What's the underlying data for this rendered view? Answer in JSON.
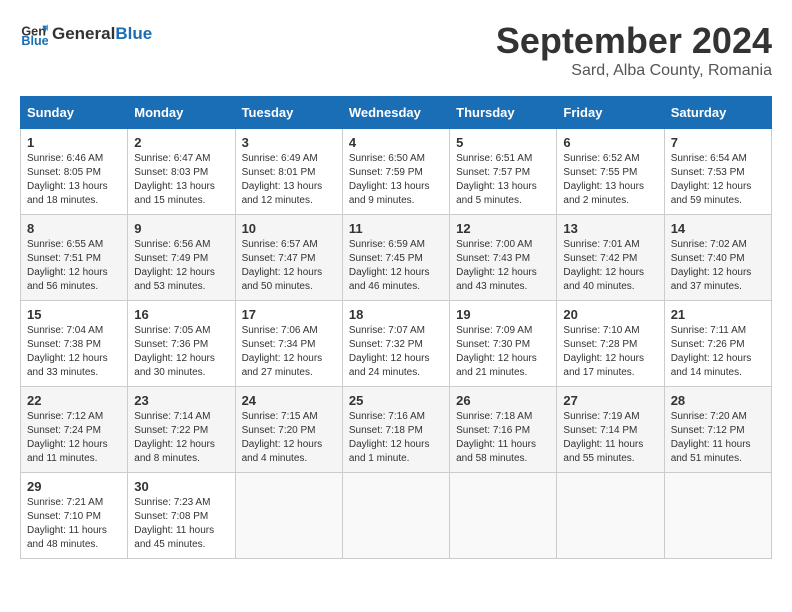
{
  "logo": {
    "text_general": "General",
    "text_blue": "Blue"
  },
  "header": {
    "title": "September 2024",
    "subtitle": "Sard, Alba County, Romania"
  },
  "columns": [
    "Sunday",
    "Monday",
    "Tuesday",
    "Wednesday",
    "Thursday",
    "Friday",
    "Saturday"
  ],
  "weeks": [
    [
      {
        "day": "1",
        "sunrise": "Sunrise: 6:46 AM",
        "sunset": "Sunset: 8:05 PM",
        "daylight": "Daylight: 13 hours and 18 minutes."
      },
      {
        "day": "2",
        "sunrise": "Sunrise: 6:47 AM",
        "sunset": "Sunset: 8:03 PM",
        "daylight": "Daylight: 13 hours and 15 minutes."
      },
      {
        "day": "3",
        "sunrise": "Sunrise: 6:49 AM",
        "sunset": "Sunset: 8:01 PM",
        "daylight": "Daylight: 13 hours and 12 minutes."
      },
      {
        "day": "4",
        "sunrise": "Sunrise: 6:50 AM",
        "sunset": "Sunset: 7:59 PM",
        "daylight": "Daylight: 13 hours and 9 minutes."
      },
      {
        "day": "5",
        "sunrise": "Sunrise: 6:51 AM",
        "sunset": "Sunset: 7:57 PM",
        "daylight": "Daylight: 13 hours and 5 minutes."
      },
      {
        "day": "6",
        "sunrise": "Sunrise: 6:52 AM",
        "sunset": "Sunset: 7:55 PM",
        "daylight": "Daylight: 13 hours and 2 minutes."
      },
      {
        "day": "7",
        "sunrise": "Sunrise: 6:54 AM",
        "sunset": "Sunset: 7:53 PM",
        "daylight": "Daylight: 12 hours and 59 minutes."
      }
    ],
    [
      {
        "day": "8",
        "sunrise": "Sunrise: 6:55 AM",
        "sunset": "Sunset: 7:51 PM",
        "daylight": "Daylight: 12 hours and 56 minutes."
      },
      {
        "day": "9",
        "sunrise": "Sunrise: 6:56 AM",
        "sunset": "Sunset: 7:49 PM",
        "daylight": "Daylight: 12 hours and 53 minutes."
      },
      {
        "day": "10",
        "sunrise": "Sunrise: 6:57 AM",
        "sunset": "Sunset: 7:47 PM",
        "daylight": "Daylight: 12 hours and 50 minutes."
      },
      {
        "day": "11",
        "sunrise": "Sunrise: 6:59 AM",
        "sunset": "Sunset: 7:45 PM",
        "daylight": "Daylight: 12 hours and 46 minutes."
      },
      {
        "day": "12",
        "sunrise": "Sunrise: 7:00 AM",
        "sunset": "Sunset: 7:43 PM",
        "daylight": "Daylight: 12 hours and 43 minutes."
      },
      {
        "day": "13",
        "sunrise": "Sunrise: 7:01 AM",
        "sunset": "Sunset: 7:42 PM",
        "daylight": "Daylight: 12 hours and 40 minutes."
      },
      {
        "day": "14",
        "sunrise": "Sunrise: 7:02 AM",
        "sunset": "Sunset: 7:40 PM",
        "daylight": "Daylight: 12 hours and 37 minutes."
      }
    ],
    [
      {
        "day": "15",
        "sunrise": "Sunrise: 7:04 AM",
        "sunset": "Sunset: 7:38 PM",
        "daylight": "Daylight: 12 hours and 33 minutes."
      },
      {
        "day": "16",
        "sunrise": "Sunrise: 7:05 AM",
        "sunset": "Sunset: 7:36 PM",
        "daylight": "Daylight: 12 hours and 30 minutes."
      },
      {
        "day": "17",
        "sunrise": "Sunrise: 7:06 AM",
        "sunset": "Sunset: 7:34 PM",
        "daylight": "Daylight: 12 hours and 27 minutes."
      },
      {
        "day": "18",
        "sunrise": "Sunrise: 7:07 AM",
        "sunset": "Sunset: 7:32 PM",
        "daylight": "Daylight: 12 hours and 24 minutes."
      },
      {
        "day": "19",
        "sunrise": "Sunrise: 7:09 AM",
        "sunset": "Sunset: 7:30 PM",
        "daylight": "Daylight: 12 hours and 21 minutes."
      },
      {
        "day": "20",
        "sunrise": "Sunrise: 7:10 AM",
        "sunset": "Sunset: 7:28 PM",
        "daylight": "Daylight: 12 hours and 17 minutes."
      },
      {
        "day": "21",
        "sunrise": "Sunrise: 7:11 AM",
        "sunset": "Sunset: 7:26 PM",
        "daylight": "Daylight: 12 hours and 14 minutes."
      }
    ],
    [
      {
        "day": "22",
        "sunrise": "Sunrise: 7:12 AM",
        "sunset": "Sunset: 7:24 PM",
        "daylight": "Daylight: 12 hours and 11 minutes."
      },
      {
        "day": "23",
        "sunrise": "Sunrise: 7:14 AM",
        "sunset": "Sunset: 7:22 PM",
        "daylight": "Daylight: 12 hours and 8 minutes."
      },
      {
        "day": "24",
        "sunrise": "Sunrise: 7:15 AM",
        "sunset": "Sunset: 7:20 PM",
        "daylight": "Daylight: 12 hours and 4 minutes."
      },
      {
        "day": "25",
        "sunrise": "Sunrise: 7:16 AM",
        "sunset": "Sunset: 7:18 PM",
        "daylight": "Daylight: 12 hours and 1 minute."
      },
      {
        "day": "26",
        "sunrise": "Sunrise: 7:18 AM",
        "sunset": "Sunset: 7:16 PM",
        "daylight": "Daylight: 11 hours and 58 minutes."
      },
      {
        "day": "27",
        "sunrise": "Sunrise: 7:19 AM",
        "sunset": "Sunset: 7:14 PM",
        "daylight": "Daylight: 11 hours and 55 minutes."
      },
      {
        "day": "28",
        "sunrise": "Sunrise: 7:20 AM",
        "sunset": "Sunset: 7:12 PM",
        "daylight": "Daylight: 11 hours and 51 minutes."
      }
    ],
    [
      {
        "day": "29",
        "sunrise": "Sunrise: 7:21 AM",
        "sunset": "Sunset: 7:10 PM",
        "daylight": "Daylight: 11 hours and 48 minutes."
      },
      {
        "day": "30",
        "sunrise": "Sunrise: 7:23 AM",
        "sunset": "Sunset: 7:08 PM",
        "daylight": "Daylight: 11 hours and 45 minutes."
      },
      null,
      null,
      null,
      null,
      null
    ]
  ]
}
